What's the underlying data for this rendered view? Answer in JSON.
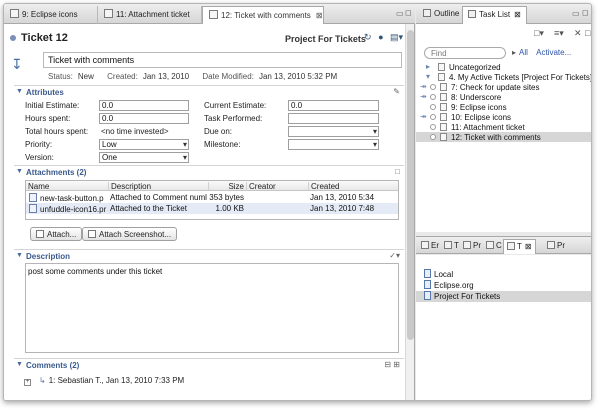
{
  "editor": {
    "tabs": [
      {
        "label": "9: Eclipse icons"
      },
      {
        "label": "11: Attachment ticket"
      },
      {
        "label": "12: Ticket with comments",
        "close": "⊠"
      }
    ],
    "title": "Ticket 12",
    "project": "Project For Tickets",
    "summary": "Ticket with comments",
    "status_line": {
      "status_label": "Status:",
      "status": "New",
      "created_label": "Created:",
      "created": "Jan 13, 2010",
      "modified_label": "Date Modified:",
      "modified": "Jan 13, 2010 5:32 PM"
    },
    "attributes": {
      "title": "Attributes",
      "left": [
        {
          "label": "Initial Estimate:",
          "value": "0.0"
        },
        {
          "label": "Hours spent:",
          "value": "0.0"
        },
        {
          "label": "Total hours spent:",
          "value": "<no time invested>"
        },
        {
          "label": "Priority:",
          "value": "Low"
        },
        {
          "label": "Version:",
          "value": "One"
        }
      ],
      "right": [
        {
          "label": "Current Estimate:",
          "value": "0.0"
        },
        {
          "label": "Task Performed:",
          "value": ""
        },
        {
          "label": "Due on:",
          "value": ""
        },
        {
          "label": "Milestone:",
          "value": ""
        }
      ]
    },
    "attachments": {
      "title": "Attachments (2)",
      "columns": [
        "Name",
        "Description",
        "Size",
        "Creator",
        "Created"
      ],
      "rows": [
        {
          "name": "new-task-button.p",
          "description": "Attached to Comment numl",
          "size": "353 bytes",
          "creator": "",
          "created": "Jan 13, 2010 5:34"
        },
        {
          "name": "unfuddle-icon16.pr",
          "description": "Attached to the Ticket",
          "size": "1.00 KB",
          "creator": "",
          "created": "Jan 13, 2010 7:48"
        }
      ],
      "attach_button": "Attach...",
      "screenshot_button": "Attach Screenshot..."
    },
    "description": {
      "title": "Description",
      "text": "post some comments under this ticket"
    },
    "comments": {
      "title": "Comments (2)",
      "items": [
        {
          "text": "1: Sebastian T., Jan 13, 2010 7:33 PM"
        }
      ]
    }
  },
  "right_top": {
    "tabs": [
      {
        "label": "Outline"
      },
      {
        "label": "Task List"
      }
    ],
    "find_placeholder": "Find",
    "all_link": "All",
    "activate_link": "Activate...",
    "tasks": [
      {
        "label": "Uncategorized",
        "indent": 1
      },
      {
        "label": "4. My Active Tickets  [Project For Tickets]",
        "indent": 1
      },
      {
        "label": "7: Check for update sites",
        "indent": 2
      },
      {
        "label": "8: Underscore",
        "indent": 2
      },
      {
        "label": "9: Eclipse icons",
        "indent": 2
      },
      {
        "label": "10: Eclipse icons",
        "indent": 2
      },
      {
        "label": "11: Attachment ticket",
        "indent": 2
      },
      {
        "label": "12: Ticket with comments",
        "indent": 2,
        "selected": true
      }
    ]
  },
  "right_bottom": {
    "tabs": [
      {
        "label": "Er"
      },
      {
        "label": "T"
      },
      {
        "label": "Pr"
      },
      {
        "label": "C"
      },
      {
        "label": "T"
      },
      {
        "label": "Pr"
      }
    ],
    "repositories": [
      {
        "label": "Local"
      },
      {
        "label": "Eclipse.org"
      },
      {
        "label": "Project For Tickets",
        "selected": true
      }
    ]
  },
  "colors": {
    "accent": "#3a5a8c",
    "selection": "#d6d6d6",
    "link": "#2a55a8"
  }
}
